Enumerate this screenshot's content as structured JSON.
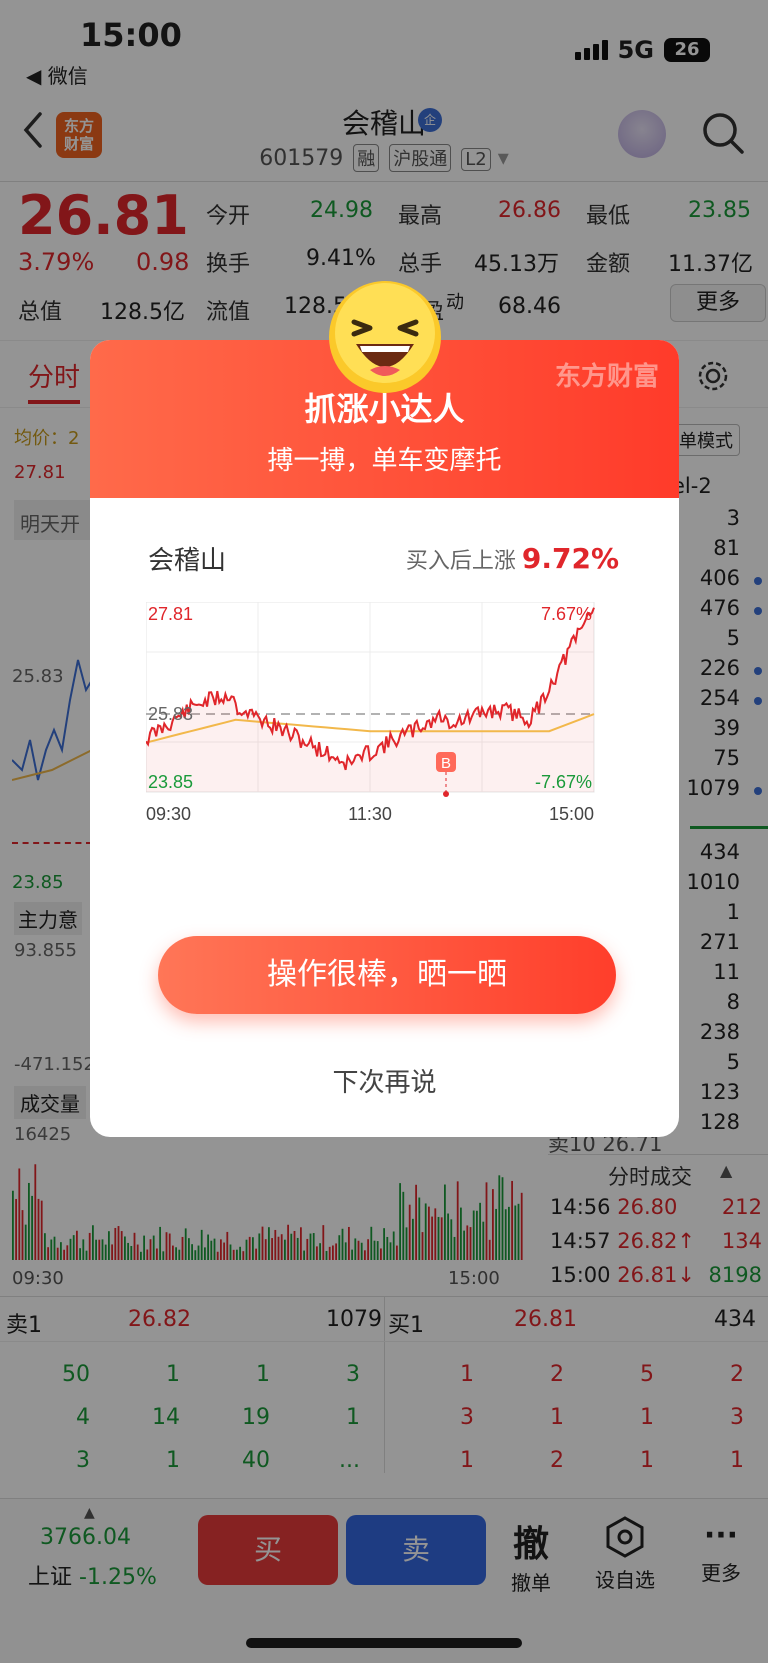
{
  "status_bar": {
    "time": "15:00",
    "back_app": "◀ 微信",
    "network": "5G",
    "battery": "26"
  },
  "header": {
    "stock_name": "会稽山",
    "badge": "企",
    "code": "601579",
    "tags": [
      "融",
      "沪股通",
      "L2"
    ],
    "logo_line1": "东方",
    "logo_line2": "财富"
  },
  "quote": {
    "price": "26.81",
    "change_pct": "3.79%",
    "change": "0.98",
    "open_label": "今开",
    "open": "24.98",
    "high_label": "最高",
    "high": "26.86",
    "low_label": "最低",
    "low": "23.85",
    "turnover_label": "换手",
    "turnover": "9.41%",
    "volume_label": "总手",
    "volume": "45.13万",
    "amount_label": "金额",
    "amount": "11.37亿",
    "mktcap_label": "总值",
    "mktcap": "128.5亿",
    "float_label": "流值",
    "float_val": "128.5",
    "pe_label": "盈",
    "pe_sup": "动",
    "pe": "68.46",
    "more_label": "更多"
  },
  "chart_area": {
    "tab_label": "分时",
    "avg_label": "均价：2",
    "mode_label": "单模式",
    "level_label": "el-2",
    "high_tick": "27.81",
    "mid_tick": "25.83",
    "low_tick": "23.85",
    "news_label": "明天开",
    "fund_label": "主力意",
    "fund_high": "93.855",
    "fund_low": "-471.152",
    "vol_label": "成交量",
    "vol_max": "16425",
    "time_start": "09:30",
    "time_end": "15:00"
  },
  "depth": {
    "upper": [
      "3",
      "81",
      "406",
      "476",
      "5",
      "226",
      "254",
      "39",
      "75",
      "1079"
    ],
    "lower": [
      "434",
      "1010",
      "1",
      "271",
      "11",
      "8",
      "238",
      "5",
      "123",
      "128"
    ],
    "sell10": "卖10 26.71"
  },
  "ticks": {
    "title": "分时成交",
    "rows": [
      {
        "time": "14:56",
        "price": "26.80",
        "vol": "212"
      },
      {
        "time": "14:57",
        "price": "26.82↑",
        "vol": "134"
      },
      {
        "time": "15:00",
        "price": "26.81↓",
        "vol": "8198"
      }
    ]
  },
  "orderbook": {
    "sell1_label": "卖1",
    "sell1_price": "26.82",
    "sell1_vol": "1079",
    "buy1_label": "买1",
    "buy1_price": "26.81",
    "buy1_vol": "434",
    "left_rows": [
      [
        "50",
        "1",
        "1",
        "3"
      ],
      [
        "4",
        "14",
        "19",
        "1"
      ],
      [
        "3",
        "1",
        "40",
        "..."
      ]
    ],
    "right_rows": [
      [
        "1",
        "2",
        "5",
        "2"
      ],
      [
        "3",
        "1",
        "1",
        "3"
      ],
      [
        "1",
        "2",
        "1",
        "1"
      ]
    ]
  },
  "bottom_bar": {
    "index_value": "3766.04",
    "index_name": "上证",
    "index_change": "-1.25%",
    "buy": "买",
    "sell": "卖",
    "cancel_glyph": "撤",
    "cancel": "撤单",
    "watch": "设自选",
    "more": "更多"
  },
  "modal": {
    "brand": "东方财富",
    "title": "抓涨小达人",
    "subtitle": "搏一搏，单车变摩托",
    "stock": "会稽山",
    "gain_label": "买入后上涨",
    "gain": "9.72%",
    "chart_high": "27.81",
    "chart_mid": "25.83",
    "chart_low": "23.85",
    "pct_high": "7.67%",
    "pct_low": "-7.67%",
    "t_start": "09:30",
    "t_mid": "11:30",
    "t_end": "15:00",
    "buy_marker": "B",
    "share_button": "操作很棒，晒一晒",
    "later_button": "下次再说"
  },
  "colors": {
    "up": "#e0262b",
    "down": "#1a9a3a",
    "accent": "#ff3b2a",
    "avg_line": "#f2b84b"
  }
}
